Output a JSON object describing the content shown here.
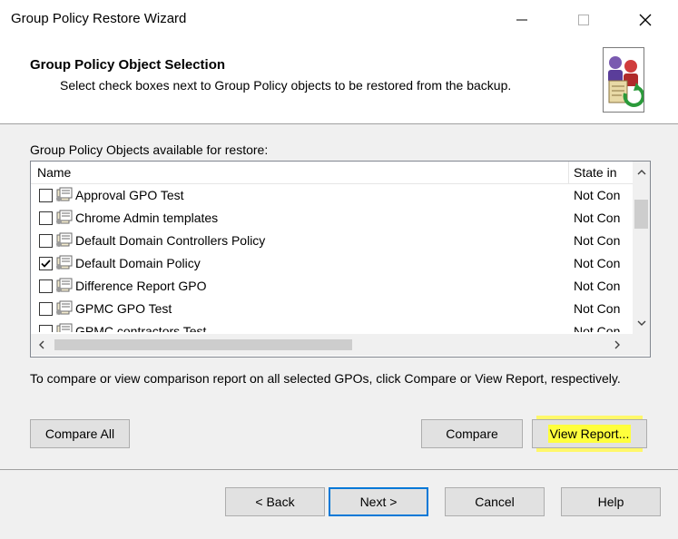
{
  "window": {
    "title": "Group Policy Restore Wizard",
    "minimize_glyph": "—",
    "maximize_glyph": "☐",
    "close_glyph": "✕"
  },
  "header": {
    "title": "Group Policy Object Selection",
    "subtitle": "Select check boxes next to Group Policy objects to be restored from the backup.",
    "icon": "gpo-restore-wizard-icon"
  },
  "list": {
    "label": "Group Policy Objects available for restore:",
    "columns": {
      "name": "Name",
      "state": "State in"
    },
    "rows": [
      {
        "name": "Approval GPO Test",
        "state": "Not Con",
        "checked": false
      },
      {
        "name": "Chrome Admin templates",
        "state": "Not Con",
        "checked": false
      },
      {
        "name": "Default Domain Controllers Policy",
        "state": "Not Con",
        "checked": false
      },
      {
        "name": "Default Domain Policy",
        "state": "Not Con",
        "checked": true
      },
      {
        "name": "Difference Report GPO",
        "state": "Not Con",
        "checked": false
      },
      {
        "name": "GPMC GPO Test",
        "state": "Not Con",
        "checked": false
      },
      {
        "name": "GPMC contractors Test",
        "state": "Not Con",
        "checked": false
      }
    ]
  },
  "compare": {
    "note": "To compare or view comparison report on all selected GPOs, click Compare or View Report, respectively.",
    "compare_all_label": "Compare All",
    "compare_label": "Compare",
    "view_report_label": "View Report...",
    "highlight_color": "#ffff3c"
  },
  "footer": {
    "back_label": "< Back",
    "next_label": "Next >",
    "cancel_label": "Cancel",
    "help_label": "Help"
  }
}
